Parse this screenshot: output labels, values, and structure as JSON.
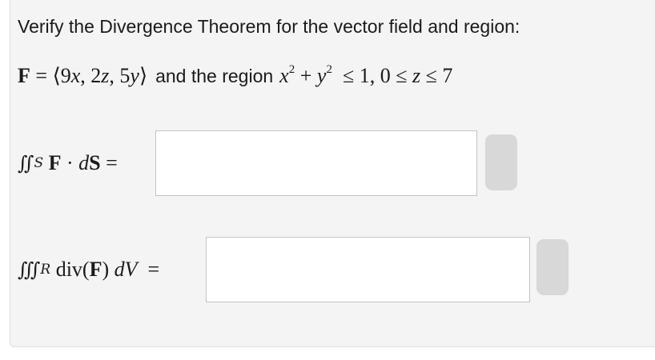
{
  "prompt": "Verify the Divergence Theorem for the vector field and region:",
  "field": {
    "symbol": "F",
    "equals": "=",
    "open": "⟨",
    "comp1": "9",
    "var1": "x",
    "sep1": ", ",
    "comp2": "2",
    "var2": "z",
    "sep2": ", ",
    "comp3": "5",
    "var3": "y",
    "close": "⟩"
  },
  "region": {
    "connector": "and the region",
    "x": "x",
    "sq1": "2",
    "plus": "+",
    "y": "y",
    "sq2": "2",
    "leq1": "≤",
    "one": "1",
    "comma": ",",
    "zero": "0",
    "leq2": "≤",
    "z": "z",
    "leq3": "≤",
    "seven": "7"
  },
  "surface_integral": {
    "integral": "∬",
    "subscript": "S",
    "field": "F",
    "dot": "·",
    "d": "d",
    "S": "S",
    "equals": "="
  },
  "volume_integral": {
    "integral": "∭",
    "subscript": "R",
    "div": "div",
    "lparen": "(",
    "field": "F",
    "rparen": ")",
    "d": "d",
    "V": "V",
    "equals": "="
  },
  "answers": {
    "surface_value": "",
    "volume_value": ""
  }
}
